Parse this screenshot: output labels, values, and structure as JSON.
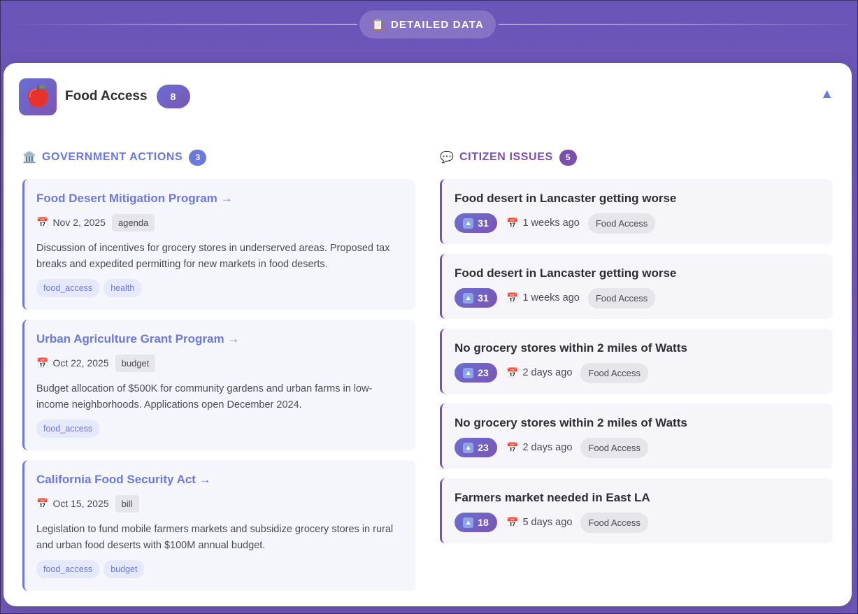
{
  "header": {
    "icon": "clipboard-icon",
    "title": "DETAILED DATA"
  },
  "category": {
    "icon": "apple-icon",
    "title": "Food Access",
    "count": "8",
    "collapse_glyph": "▲"
  },
  "government": {
    "icon": "government-building-icon",
    "title": "GOVERNMENT ACTIONS",
    "count": "3",
    "items": [
      {
        "title": "Food Desert Mitigation Program →",
        "date": "Nov 2, 2025",
        "type": "agenda",
        "description": "Discussion of incentives for grocery stores in underserved areas. Proposed tax breaks and expedited permitting for new markets in food deserts.",
        "tags": [
          "food_access",
          "health"
        ]
      },
      {
        "title": "Urban Agriculture Grant Program →",
        "date": "Oct 22, 2025",
        "type": "budget",
        "description": "Budget allocation of $500K for community gardens and urban farms in low-income neighborhoods. Applications open December 2024.",
        "tags": [
          "food_access"
        ]
      },
      {
        "title": "California Food Security Act →",
        "date": "Oct 15, 2025",
        "type": "bill",
        "description": "Legislation to fund mobile farmers markets and subsidize grocery stores in rural and urban food deserts with $100M annual budget.",
        "tags": [
          "food_access",
          "budget"
        ]
      }
    ]
  },
  "citizen": {
    "icon": "speech-bubble-icon",
    "title": "CITIZEN ISSUES",
    "count": "5",
    "items": [
      {
        "title": "Food desert in Lancaster getting worse",
        "votes": "31",
        "ago": "1 weeks ago",
        "category": "Food Access"
      },
      {
        "title": "Food desert in Lancaster getting worse",
        "votes": "31",
        "ago": "1 weeks ago",
        "category": "Food Access"
      },
      {
        "title": "No grocery stores within 2 miles of Watts",
        "votes": "23",
        "ago": "2 days ago",
        "category": "Food Access"
      },
      {
        "title": "No grocery stores within 2 miles of Watts",
        "votes": "23",
        "ago": "2 days ago",
        "category": "Food Access"
      },
      {
        "title": "Farmers market needed in East LA",
        "votes": "18",
        "ago": "5 days ago",
        "category": "Food Access"
      }
    ]
  },
  "colors": {
    "gov_accent": "#6b78dc",
    "citizen_accent": "#7b4fae",
    "background": "#7058b8"
  }
}
